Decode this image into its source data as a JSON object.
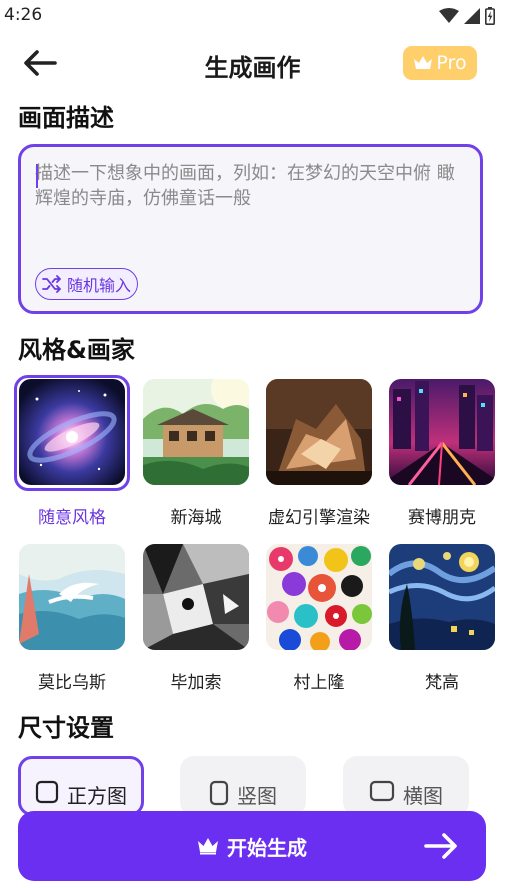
{
  "status_bar": {
    "time": "4:26",
    "icons": [
      "wifi-icon",
      "signal-icon",
      "battery-icon"
    ]
  },
  "header": {
    "title": "生成画作",
    "pro_label": "Pro"
  },
  "description": {
    "section_title": "画面描述",
    "placeholder": "描述一下想象中的画面，列如：在梦幻的天空中俯 瞰辉煌的寺庙，仿佛童话一般",
    "random_label": "随机输入"
  },
  "styles": {
    "section_title": "风格&画家",
    "selected": "随意风格",
    "items": [
      {
        "label": "随意风格"
      },
      {
        "label": "新海城"
      },
      {
        "label": "虚幻引擎渲染"
      },
      {
        "label": "赛博朋克"
      },
      {
        "label": "莫比乌斯"
      },
      {
        "label": "毕加索"
      },
      {
        "label": "村上隆"
      },
      {
        "label": "梵高"
      }
    ]
  },
  "size": {
    "section_title": "尺寸设置",
    "selected": "正方图",
    "options": [
      {
        "label": "正方图"
      },
      {
        "label": "竖图"
      },
      {
        "label": "横图"
      }
    ]
  },
  "cta": {
    "label": "开始生成"
  },
  "colors": {
    "accent": "#6a2ff0",
    "pro_bg": "#ffcf6b"
  }
}
